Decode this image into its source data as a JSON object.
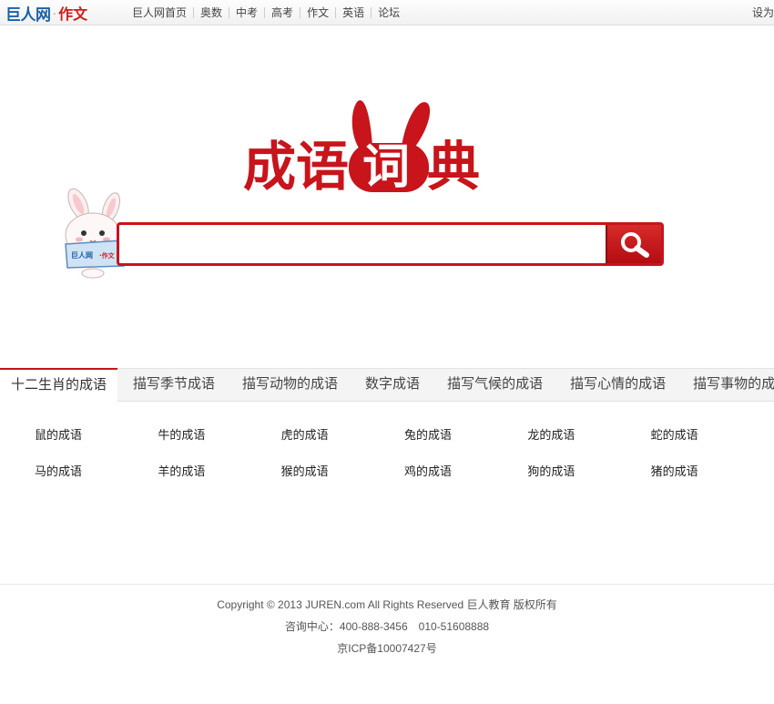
{
  "topbar": {
    "brand_main": "巨人网",
    "brand_dot": "·",
    "brand_sub": "作文",
    "nav": [
      "巨人网首页",
      "奥数",
      "中考",
      "高考",
      "作文",
      "英语",
      "论坛"
    ],
    "right_text": "设为"
  },
  "logo": {
    "text": "成语词典",
    "color": "#c8141b"
  },
  "search": {
    "value": "",
    "placeholder": "",
    "mascot_text": "巨人网·作文"
  },
  "tabs": [
    "十二生肖的成语",
    "描写季节成语",
    "描写动物的成语",
    "数字成语",
    "描写气候的成语",
    "描写心情的成语",
    "描写事物的成语"
  ],
  "grid": {
    "row1": [
      "鼠的成语",
      "牛的成语",
      "虎的成语",
      "兔的成语",
      "龙的成语",
      "蛇的成语"
    ],
    "row2": [
      "马的成语",
      "羊的成语",
      "猴的成语",
      "鸡的成语",
      "狗的成语",
      "猪的成语"
    ]
  },
  "footer": {
    "copyright": "Copyright © 2013 JUREN.com All Rights Reserved 巨人教育  版权所有",
    "hotline_label": "咨询中心：",
    "hotline_1": "400-888-3456",
    "hotline_2": "010-51608888",
    "icp": "京ICP备10007427号"
  },
  "colors": {
    "accent": "#c8141b",
    "brand_blue": "#1d5fa8"
  }
}
